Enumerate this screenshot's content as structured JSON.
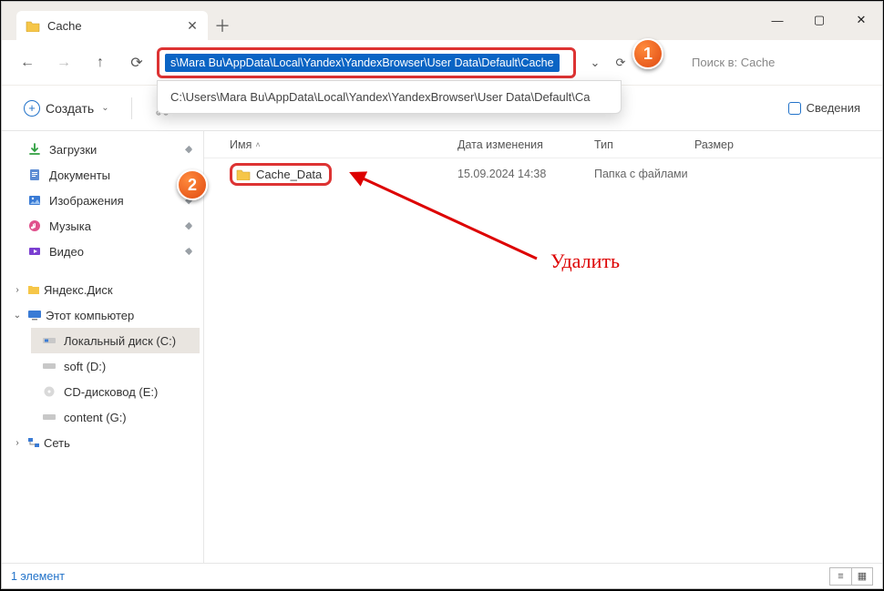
{
  "tab": {
    "title": "Cache"
  },
  "window_buttons": {
    "min": "—",
    "max": "▢",
    "close": "✕"
  },
  "nav": {
    "back": "←",
    "forward": "→",
    "up": "↑",
    "refresh": "⟳",
    "address_selected": "s\\Mara Bu\\AppData\\Local\\Yandex\\YandexBrowser\\User Data\\Default\\Cache",
    "address_suggest": "C:\\Users\\Mara Bu\\AppData\\Local\\Yandex\\YandexBrowser\\User Data\\Default\\Ca",
    "dropdown": "⌄",
    "reload": "⟳",
    "clear": "✕",
    "search_placeholder": "Поиск в: Cache"
  },
  "toolbar": {
    "create_label": "Создать",
    "details_label": "Сведения"
  },
  "sidebar": {
    "pinned": [
      {
        "icon": "download",
        "label": "Загрузки",
        "color": "#2e9e3f"
      },
      {
        "icon": "doc",
        "label": "Документы",
        "color": "#3a7bd5"
      },
      {
        "icon": "picture",
        "label": "Изображения",
        "color": "#3a7bd5"
      },
      {
        "icon": "music",
        "label": "Музыка",
        "color": "#e0518c"
      },
      {
        "icon": "video",
        "label": "Видео",
        "color": "#7b3fd1"
      }
    ],
    "yadisk": "Яндекс.Диск",
    "thispc": "Этот компьютер",
    "drives": [
      {
        "label": "Локальный диск (C:)",
        "sel": true
      },
      {
        "label": "soft (D:)"
      },
      {
        "label": "CD-дисковод (E:)"
      },
      {
        "label": "content (G:)"
      }
    ],
    "network": "Сеть"
  },
  "columns": {
    "name": "Имя",
    "modified": "Дата изменения",
    "type": "Тип",
    "size": "Размер"
  },
  "files": [
    {
      "name": "Cache_Data",
      "modified": "15.09.2024 14:38",
      "type": "Папка с файлами"
    }
  ],
  "annot": {
    "step1": "1",
    "step2": "2",
    "delete_label": "Удалить"
  },
  "status": {
    "count": "1 элемент"
  }
}
